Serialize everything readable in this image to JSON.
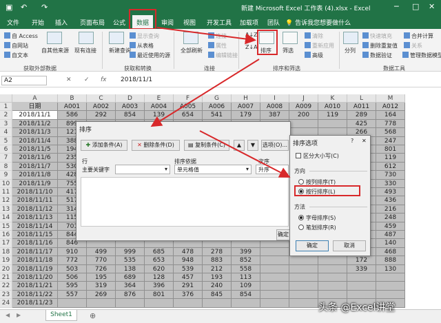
{
  "window": {
    "title": "新建 Microsoft Excel 工作表 (4).xlsx - Excel"
  },
  "ribbon_tabs": [
    "文件",
    "开始",
    "插入",
    "页面布局",
    "公式",
    "数据",
    "审阅",
    "视图",
    "开发工具",
    "加载项",
    "团队"
  ],
  "active_tab": "数据",
  "tell_me": "告诉我您想要做什么",
  "ribbon": {
    "access": "自 Access",
    "web": "自网站",
    "text": "自文本",
    "other_sources": "自其他来源",
    "existing_conn": "现有连接",
    "group_external": "获取外部数据",
    "new_query": "新建查询",
    "show_query": "显示查询",
    "from_table": "从表格",
    "recent_sources": "最近使用的源",
    "group_transform": "获取和转换",
    "refresh_all": "全部刷新",
    "connections": "连接",
    "properties": "属性",
    "edit_links": "编辑链接",
    "group_connections": "连接",
    "sort": "排序",
    "filter": "筛选",
    "clear": "清除",
    "reapply": "重新应用",
    "advanced": "高级",
    "group_sort": "排序和筛选",
    "text_to_columns": "分列",
    "flash_fill": "快速填充",
    "remove_dup": "删除重复值",
    "validation": "数据验证",
    "consolidate": "合并计算",
    "relationships": "关系",
    "manage_model": "管理数据模型",
    "group_tools": "数据工具"
  },
  "formula_bar": {
    "name_box": "A2",
    "fx": "fx",
    "value": "2018/11/1"
  },
  "grid": {
    "col_letters": [
      "A",
      "B",
      "C",
      "D",
      "E",
      "F",
      "G",
      "H",
      "I",
      "J",
      "K",
      "L",
      "M"
    ],
    "header_row": [
      "日期",
      "A001",
      "A002",
      "A003",
      "A004",
      "A005",
      "A006",
      "A007",
      "A008",
      "A009",
      "A010",
      "A011",
      "A012"
    ],
    "dates": [
      "2018/11/1",
      "2018/11/2",
      "2018/11/3",
      "2018/11/4",
      "2018/11/5",
      "2018/11/6",
      "2018/11/7",
      "2018/11/8",
      "2018/11/9",
      "2018/11/10",
      "2018/11/11",
      "2018/11/12",
      "2018/11/13",
      "2018/11/14",
      "2018/11/15",
      "2018/11/16",
      "2018/11/17",
      "2018/11/18",
      "2018/11/19",
      "2018/11/20",
      "2018/11/21",
      "2018/11/22",
      "2018/11/23"
    ],
    "rows": [
      [
        "586",
        "292",
        "854",
        "139",
        "654",
        "541",
        "179",
        "387",
        "200",
        "119",
        "289",
        "164"
      ],
      [
        "899",
        "",
        "",
        "",
        "",
        "",
        "",
        "",
        "",
        "",
        "425",
        "778"
      ],
      [
        "121",
        "",
        "",
        "",
        "",
        "",
        "",
        "",
        "",
        "",
        "266",
        "568"
      ],
      [
        "388",
        "",
        "",
        "",
        "",
        "",
        "",
        "",
        "",
        "",
        "183",
        "247"
      ],
      [
        "194",
        "",
        "",
        "",
        "",
        "",
        "",
        "",
        "",
        "",
        "436",
        "801"
      ],
      [
        "235",
        "",
        "",
        "",
        "",
        "",
        "",
        "",
        "",
        "",
        "305",
        "119"
      ],
      [
        "530",
        "",
        "",
        "",
        "",
        "",
        "",
        "",
        "",
        "",
        "297",
        "612"
      ],
      [
        "428",
        "",
        "",
        "",
        "",
        "",
        "",
        "",
        "",
        "",
        "218",
        "730"
      ],
      [
        "755",
        "",
        "",
        "",
        "",
        "",
        "",
        "",
        "",
        "",
        "393",
        "330"
      ],
      [
        "417",
        "",
        "",
        "",
        "",
        "",
        "",
        "",
        "",
        "",
        "540",
        "493"
      ],
      [
        "517",
        "",
        "",
        "",
        "",
        "",
        "",
        "",
        "",
        "",
        "971",
        "436"
      ],
      [
        "314",
        "",
        "",
        "",
        "",
        "",
        "",
        "",
        "",
        "",
        "858",
        "216"
      ],
      [
        "115",
        "",
        "",
        "",
        "",
        "",
        "",
        "",
        "",
        "",
        "619",
        "248"
      ],
      [
        "701",
        "",
        "",
        "",
        "",
        "",
        "",
        "",
        "",
        "",
        "223",
        "459"
      ],
      [
        "844",
        "",
        "",
        "",
        "",
        "",
        "",
        "",
        "",
        "",
        "440",
        "487"
      ],
      [
        "846",
        "",
        "",
        "",
        "",
        "",
        "",
        "",
        "",
        "",
        "277",
        "140"
      ],
      [
        "910",
        "499",
        "999",
        "685",
        "478",
        "278",
        "399",
        "",
        "",
        "",
        "327",
        "468"
      ],
      [
        "772",
        "770",
        "535",
        "653",
        "948",
        "883",
        "852",
        "",
        "",
        "",
        "172",
        "888"
      ],
      [
        "503",
        "726",
        "138",
        "620",
        "539",
        "212",
        "558",
        "",
        "",
        "",
        "339",
        "130"
      ],
      [
        "506",
        "195",
        "689",
        "128",
        "457",
        "193",
        "113",
        "",
        "",
        "",
        "",
        ""
      ],
      [
        "595",
        "319",
        "364",
        "396",
        "291",
        "240",
        "109",
        "",
        "",
        "",
        "",
        ""
      ],
      [
        "557",
        "269",
        "876",
        "801",
        "376",
        "845",
        "854",
        "",
        "",
        "",
        "",
        ""
      ],
      [
        "",
        "",
        "",
        "",
        "",
        "",
        "",
        "",
        "",
        "",
        "",
        ""
      ]
    ]
  },
  "sort_dialog": {
    "title": "排序",
    "add_level": "添加条件(A)",
    "delete_level": "删除条件(D)",
    "copy_level": "复制条件(C)",
    "options": "选项(O)...",
    "col_row": "行",
    "col_sort_on": "排序依据",
    "col_order": "次序",
    "primary_key": "主要关键字",
    "sort_on_value": "单元格值",
    "order_value": "升序",
    "ok": "确定"
  },
  "options_dialog": {
    "title": "排序选项",
    "help": "?",
    "close": "✕",
    "case_sensitive": "区分大小写(C)",
    "orientation_label": "方向",
    "by_column": "按列排序(T)",
    "by_row": "按行排序(L)",
    "method_label": "方法",
    "alphabetic": "字母排序(S)",
    "stroke": "笔划排序(R)",
    "ok": "确定",
    "cancel": "取消",
    "selected_orientation": "by_row",
    "selected_method": "alphabetic"
  },
  "sheet_tab": "Sheet1",
  "watermark": "头条 @Excel讲堂",
  "colors": {
    "excel_green": "#217346",
    "highlight_red": "#d8282a"
  }
}
